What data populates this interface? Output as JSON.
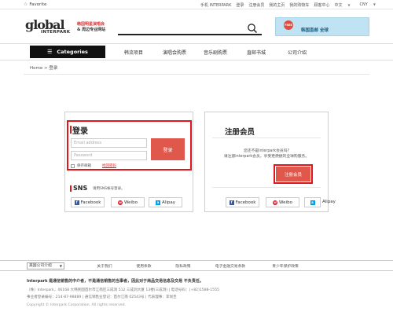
{
  "topbar": {
    "favorite": "Favorite",
    "links": [
      "手机 INTERPARK",
      "登录",
      "注册会员",
      "我的主页",
      "我的购物车",
      "顾客中心",
      "中文",
      "CNY"
    ]
  },
  "header": {
    "logo_main": "global",
    "logo_sub": "INTERPARK",
    "logo_tag1": "韩国明星演唱会",
    "logo_tag2": "& 周边专业网站",
    "search_placeholder": "",
    "banner_badge": "FREE",
    "banner_text": "韩国直邮 全球"
  },
  "nav": {
    "categories_label": "Categories",
    "links": [
      "韩流项目",
      "演唱会购票",
      "音乐剧购票",
      "直邮书城",
      "公司介绍"
    ]
  },
  "breadcrumb": {
    "home": "Home",
    "sep": ">",
    "current": "登录"
  },
  "login": {
    "title": "登录",
    "email_placeholder": "Email address",
    "password_placeholder": "Password",
    "login_button": "登录",
    "keep_logged_in": "保存邮箱",
    "forgot": "找回密码"
  },
  "sns": {
    "title": "SNS",
    "desc": "请用SNS帐号登录。",
    "buttons": [
      "Facebook",
      "Weibo",
      "Alipay"
    ]
  },
  "register": {
    "title": "注册会员",
    "question": "您还不是interpark会员吗?",
    "desc": "请注册interpark会员，享受更便捷的全球购服务。",
    "button": "注册会员",
    "sns_buttons": [
      "Facebook",
      "Weibo",
      "Alipay"
    ]
  },
  "footer": {
    "company_select": "美国公司介绍",
    "links": [
      "关于我们",
      "使用条款",
      "隐私政策",
      "电子金融交易条款",
      "青少年保护政策"
    ],
    "desc": "Interpark 是通信销售的中介者，不是通信销售的当事者，因此对于商品交易信息及交易 不负责任。",
    "line1": "（株）Interpark，06168 大韩民国首尔市江南区三成洞 512 三成洞大厦 13楼(三成洞) | 电话号码：(+82)1588-1555",
    "line2": "事业者登录编号：214-87-98889 | 通信销售业登记：首尔江南 02543号 | 代表理事：李尚圭",
    "copyright": "Copyright © Interpark Corporation. All rights reserved."
  },
  "colors": {
    "accent_red": "#e0161b",
    "button_red": "#e0584c",
    "nav_black": "#111111"
  }
}
